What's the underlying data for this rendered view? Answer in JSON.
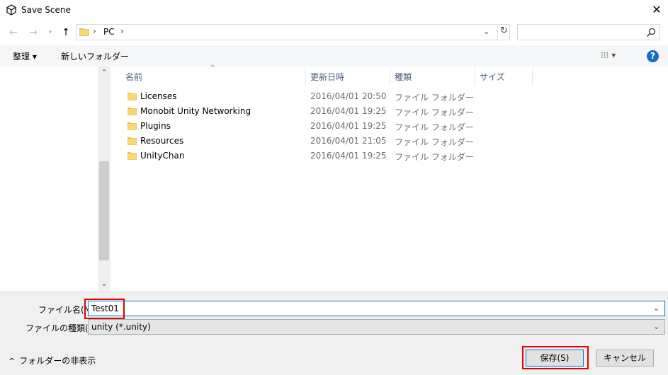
{
  "window": {
    "title": "Save Scene",
    "close_glyph": "✕"
  },
  "nav": {
    "back_icon": "arrow-left-icon",
    "forward_icon": "arrow-right-icon",
    "recent_icon": "chevron-down-icon",
    "up_icon": "arrow-up-icon",
    "address": {
      "location": "PC",
      "separator": "›"
    },
    "search": {
      "placeholder": ""
    }
  },
  "toolbar": {
    "organize_label": "整理 ▾",
    "new_folder_label": "新しいフォルダー",
    "view_label": "⁝⁝⁝ ▾",
    "help_label": "?"
  },
  "file_list": {
    "columns": [
      "名前",
      "更新日時",
      "種類",
      "サイズ"
    ],
    "rows": [
      {
        "name": "Licenses",
        "modified": "2016/04/01 20:50",
        "type": "ファイル フォルダー",
        "size": ""
      },
      {
        "name": "Monobit Unity Networking",
        "modified": "2016/04/01 19:25",
        "type": "ファイル フォルダー",
        "size": ""
      },
      {
        "name": "Plugins",
        "modified": "2016/04/01 19:25",
        "type": "ファイル フォルダー",
        "size": ""
      },
      {
        "name": "Resources",
        "modified": "2016/04/01 21:05",
        "type": "ファイル フォルダー",
        "size": ""
      },
      {
        "name": "UnityChan",
        "modified": "2016/04/01 19:25",
        "type": "ファイル フォルダー",
        "size": ""
      }
    ]
  },
  "form": {
    "filename_label": "ファイル名(N):",
    "filename_value": "Test01",
    "filetype_label": "ファイルの種類(T):",
    "filetype_value": "unity (*.unity)"
  },
  "footer": {
    "hide_folders_label": "フォルダーの非表示",
    "save_label": "保存(S)",
    "cancel_label": "キャンセル"
  },
  "colors": {
    "accent": "#0078d7",
    "highlight": "#e00000",
    "folder": "#f8d775",
    "help": "#1a6bc8"
  }
}
